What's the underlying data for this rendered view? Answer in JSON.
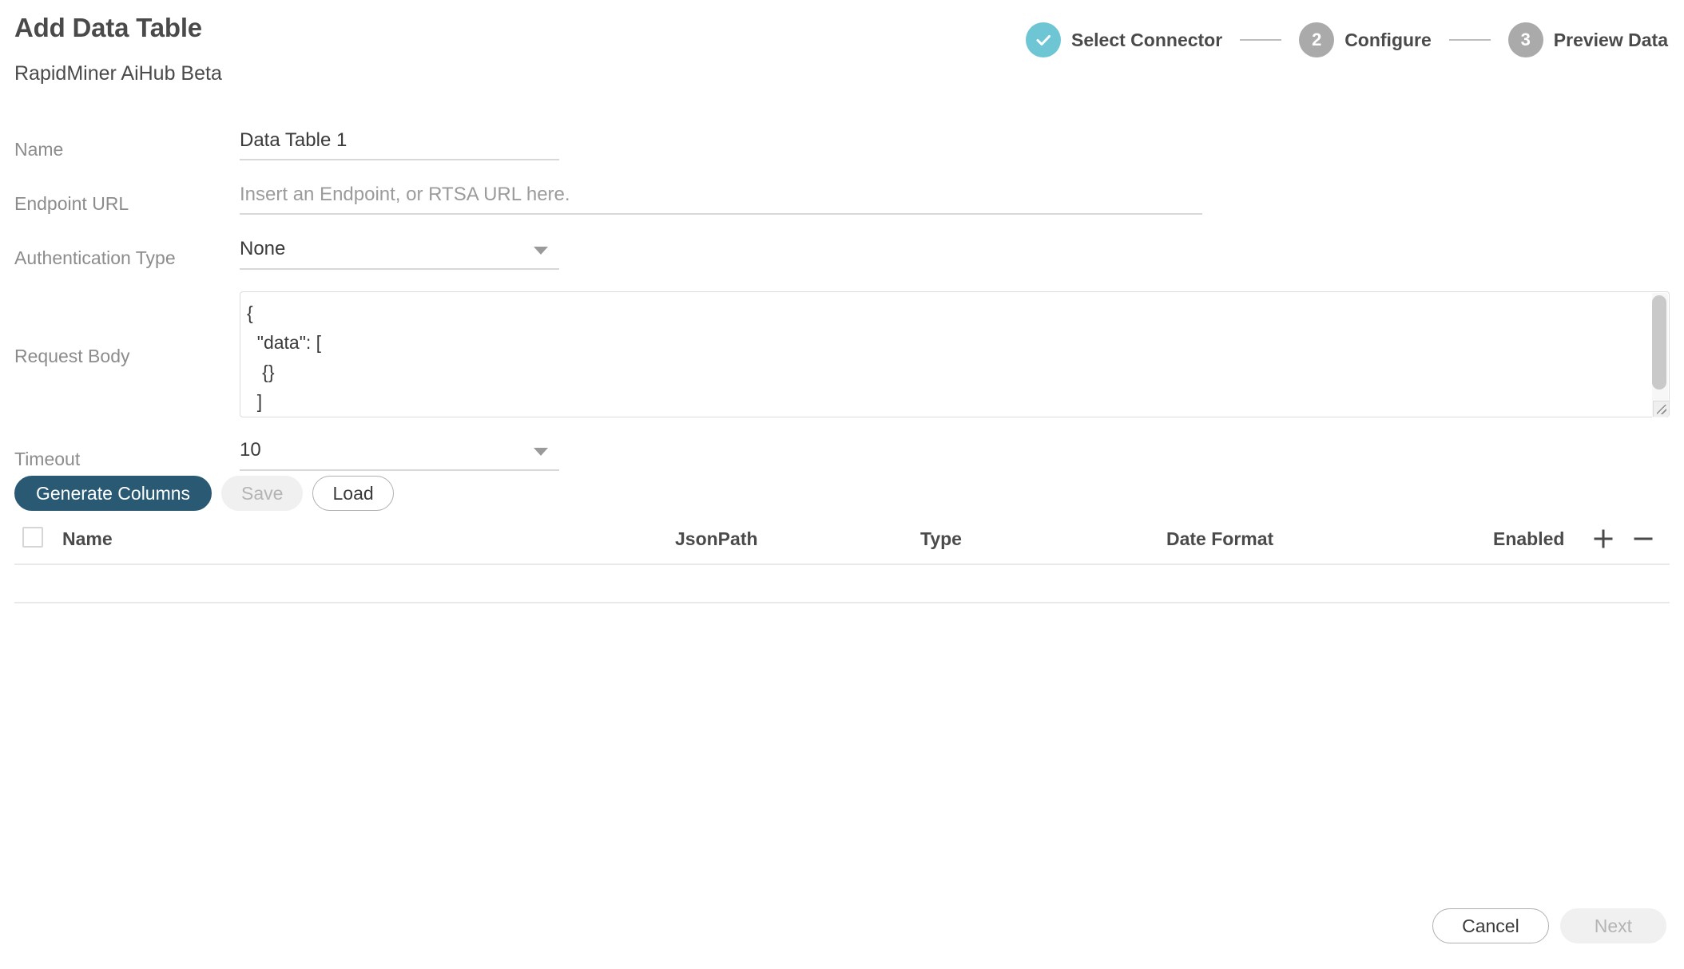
{
  "header": {
    "title": "Add Data Table",
    "subtitle": "RapidMiner AiHub Beta"
  },
  "stepper": {
    "steps": [
      {
        "label": "Select Connector",
        "badge": "check",
        "state": "completed"
      },
      {
        "label": "Configure",
        "badge": "2",
        "state": "current"
      },
      {
        "label": "Preview Data",
        "badge": "3",
        "state": "upcoming"
      }
    ],
    "accent_color": "#6ec6d4",
    "idle_color": "#aaaaaa"
  },
  "form": {
    "name": {
      "label": "Name",
      "value": "Data Table 1",
      "placeholder": ""
    },
    "endpoint_url": {
      "label": "Endpoint URL",
      "value": "",
      "placeholder": "Insert an Endpoint, or RTSA URL here."
    },
    "authentication_type": {
      "label": "Authentication Type",
      "value": "None",
      "options": [
        "None"
      ]
    },
    "request_body": {
      "label": "Request Body",
      "value": "{\n  \"data\": [\n   {}\n  ]"
    },
    "timeout": {
      "label": "Timeout",
      "value": "10",
      "options": [
        "10"
      ]
    }
  },
  "actions": {
    "generate_columns": {
      "label": "Generate Columns",
      "enabled": true
    },
    "save": {
      "label": "Save",
      "enabled": false
    },
    "load": {
      "label": "Load",
      "enabled": true
    }
  },
  "columns_table": {
    "select_all_checked": false,
    "headers": {
      "name": "Name",
      "jsonpath": "JsonPath",
      "type": "Type",
      "date_format": "Date Format",
      "enabled": "Enabled"
    },
    "add_icon": "plus-icon",
    "remove_icon": "minus-icon",
    "rows": []
  },
  "footer": {
    "cancel": {
      "label": "Cancel",
      "enabled": true
    },
    "next": {
      "label": "Next",
      "enabled": false
    }
  }
}
